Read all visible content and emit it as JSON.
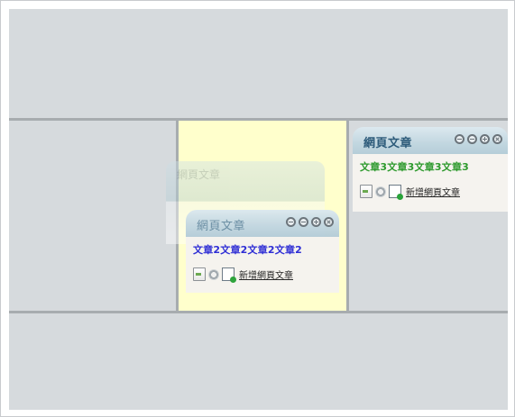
{
  "widgets": {
    "ghost": {
      "title": "網頁文章"
    },
    "middle": {
      "title": "網頁文章",
      "article": "文章2文章2文章2文章2",
      "new_link": "新增網頁文章",
      "colors": {
        "article": "#2b2bd6"
      }
    },
    "right": {
      "title": "網頁文章",
      "article": "文章3文章3文章3文章3",
      "new_link": "新增網頁文章",
      "colors": {
        "article": "#2d9a2d"
      }
    }
  },
  "icons": [
    "document-icon",
    "gear-icon",
    "new-page-icon",
    "minimize-icon",
    "maximize-icon",
    "expand-icon",
    "close-icon"
  ]
}
